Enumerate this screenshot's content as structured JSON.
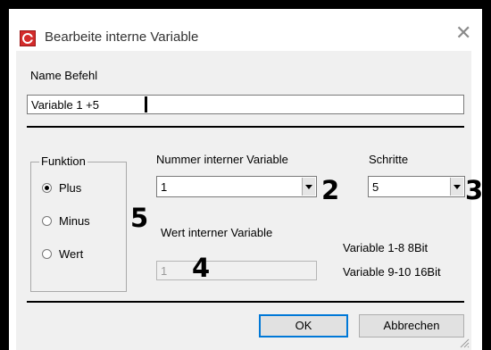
{
  "window": {
    "title": "Bearbeite interne Variable",
    "app_icon": "app-logo-icon",
    "close_icon": "close-icon"
  },
  "name_field": {
    "label": "Name Befehl",
    "value": "Variable 1 +5"
  },
  "funktion": {
    "title": "Funktion",
    "options": [
      {
        "label": "Plus",
        "checked": true
      },
      {
        "label": "Minus",
        "checked": false
      },
      {
        "label": "Wert",
        "checked": false
      }
    ]
  },
  "nummer": {
    "label": "Nummer interner Variable",
    "value": "1"
  },
  "schritte": {
    "label": "Schritte",
    "value": "5"
  },
  "wert": {
    "label": "Wert interner Variable",
    "value": "1"
  },
  "info": {
    "line1": "Variable 1-8 8Bit",
    "line2": "Variable 9-10 16Bit"
  },
  "annotations": {
    "a2": "2",
    "a3": "3",
    "a4": "4",
    "a5": "5"
  },
  "buttons": {
    "ok": "OK",
    "cancel": "Abbrechen"
  },
  "colors": {
    "focus_border": "#0078d7",
    "app_icon_red": "#d32b2b",
    "dialog_bg": "#f0f0f0"
  }
}
